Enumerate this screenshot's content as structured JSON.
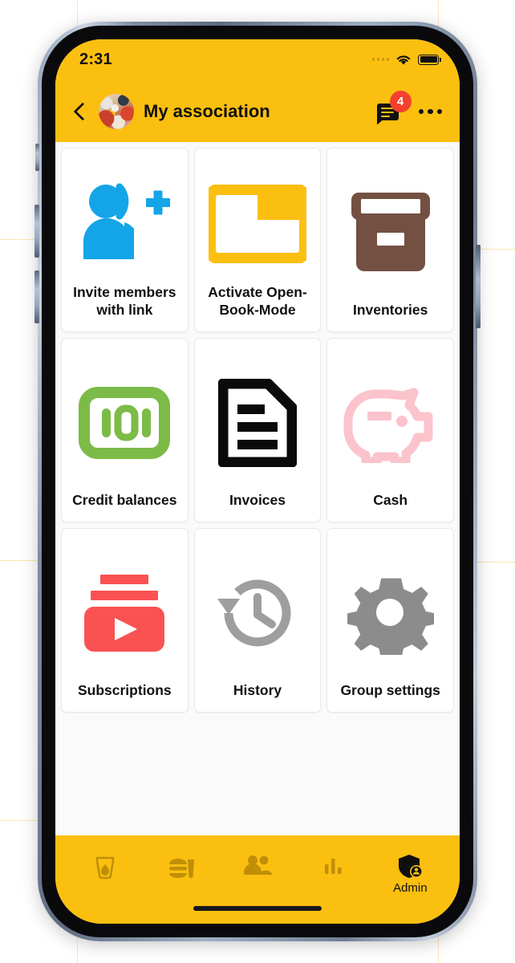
{
  "theme": {
    "brand_yellow": "#FBBF10",
    "badge_red": "#F4402F",
    "tile_bg": "#FFFFFF",
    "page_bg": "#FAFAFA",
    "text": "#111111"
  },
  "status_bar": {
    "time": "2:31",
    "signal_icon": "signal-dots-icon",
    "wifi_icon": "wifi-icon",
    "battery_icon": "battery-full-icon"
  },
  "app_bar": {
    "back_icon": "back-chevron-icon",
    "avatar_icon": "group-avatar-image",
    "title": "My association",
    "chat_icon": "chat-bubble-icon",
    "chat_badge_count": "4",
    "more_icon": "more-options-icon"
  },
  "grid": {
    "tiles": [
      {
        "label": "Invite members with link",
        "icon": "person-add-icon",
        "color": "#14A5E8"
      },
      {
        "label": "Activate Open-Book-Mode",
        "icon": "folder-icon",
        "color": "#FBBF10"
      },
      {
        "label": "Inventories",
        "icon": "archive-box-icon",
        "color": "#745043"
      },
      {
        "label": "Credit balances",
        "icon": "banknote-100-icon",
        "color": "#7CBB47"
      },
      {
        "label": "Invoices",
        "icon": "document-icon",
        "color": "#0A0A0A"
      },
      {
        "label": "Cash",
        "icon": "piggy-bank-icon",
        "color": "#FBC3CC"
      },
      {
        "label": "Subscriptions",
        "icon": "subscriptions-play-icon",
        "color": "#FA5252"
      },
      {
        "label": "History",
        "icon": "history-clock-icon",
        "color": "#9E9E9E"
      },
      {
        "label": "Group settings",
        "icon": "gear-icon",
        "color": "#8C8C8C"
      }
    ]
  },
  "bottom_nav": {
    "items": [
      {
        "label": "",
        "icon": "drink-cup-icon",
        "active": false
      },
      {
        "label": "",
        "icon": "food-meal-icon",
        "active": false
      },
      {
        "label": "",
        "icon": "people-group-icon",
        "active": false
      },
      {
        "label": "",
        "icon": "bar-chart-icon",
        "active": false
      },
      {
        "label": "Admin",
        "icon": "shield-admin-icon",
        "active": true
      }
    ]
  }
}
